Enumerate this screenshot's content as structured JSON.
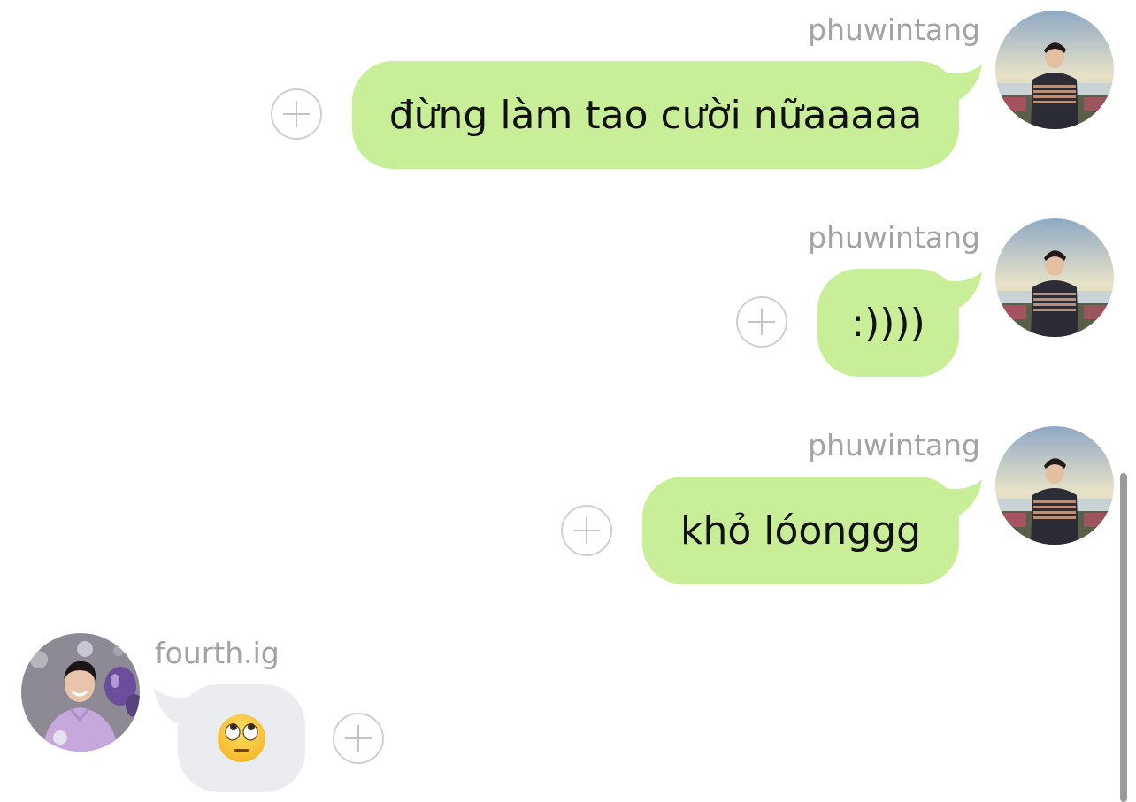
{
  "conversation": {
    "messages": [
      {
        "sender": "phuwintang",
        "text": "đừng làm tao cười nữaaaaa",
        "direction": "sent"
      },
      {
        "sender": "phuwintang",
        "text": ":))))",
        "direction": "sent"
      },
      {
        "sender": "phuwintang",
        "text": "khỏ lóonggg",
        "direction": "sent"
      },
      {
        "sender": "fourth.ig",
        "emoji": "face-with-rolling-eyes",
        "direction": "received"
      }
    ]
  },
  "icons": {
    "add_reaction": "plus-circle-icon",
    "scrollbar": "vertical-scrollbar"
  },
  "colors": {
    "sent_bubble": "#c8ef97",
    "received_bubble": "#eaecef",
    "username": "#a3a3a3",
    "add_button_outline": "#cfcfcf"
  }
}
